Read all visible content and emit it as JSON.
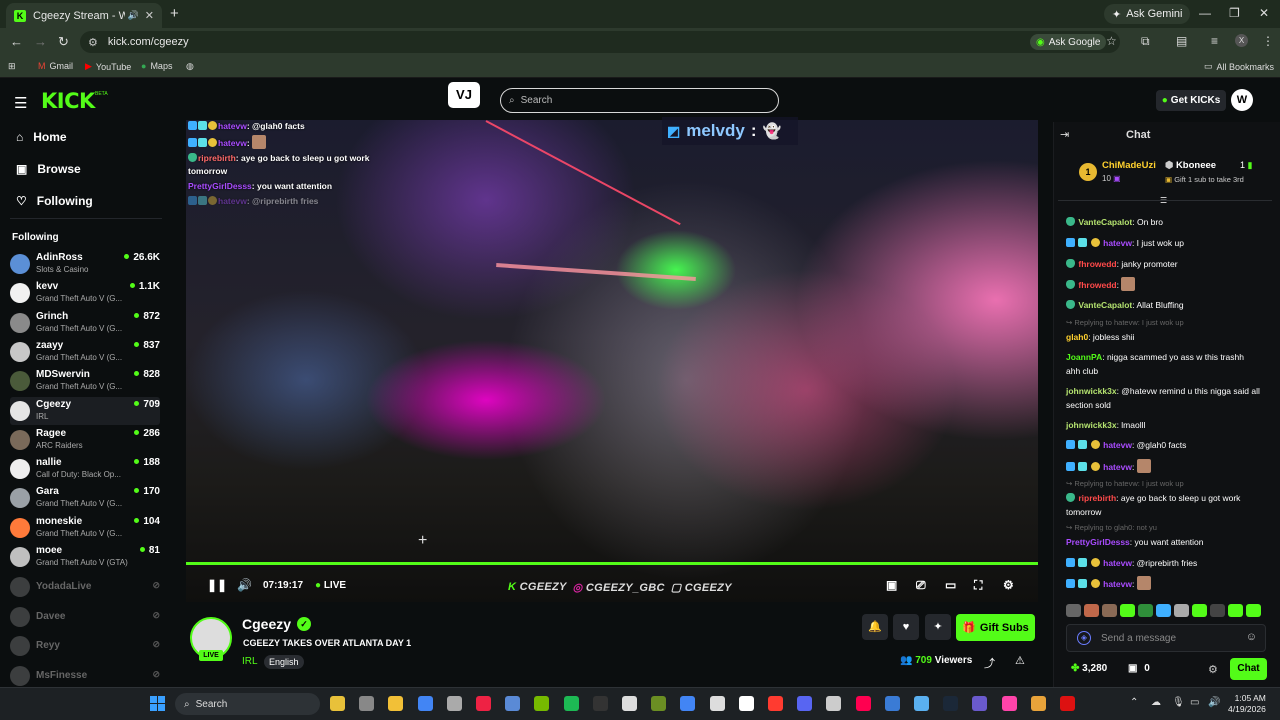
{
  "browser": {
    "tab_title": "Cgeezy Stream - Watch Live",
    "ask_gemini": "Ask Gemini",
    "url": "kick.com/cgeezy",
    "ask_google": "Ask Google",
    "bookmarks": [
      "Gmail",
      "YouTube",
      "Maps"
    ],
    "all_bookmarks": "All Bookmarks"
  },
  "header": {
    "logo": "KICK",
    "logo_tag": "BETA",
    "search_placeholder": "Search",
    "get_kicks": "Get KICKs"
  },
  "sidebar": {
    "nav": [
      "Home",
      "Browse",
      "Following"
    ],
    "section_label": "Following",
    "channels": [
      {
        "name": "AdinRoss",
        "category": "Slots & Casino",
        "viewers": "26.6K",
        "color": "#5b8fd6"
      },
      {
        "name": "kevv",
        "category": "Grand Theft Auto V (G...",
        "viewers": "1.1K",
        "color": "#f1f1f1"
      },
      {
        "name": "Grinch",
        "category": "Grand Theft Auto V (G...",
        "viewers": "872",
        "color": "#8a8a8a"
      },
      {
        "name": "zaayy",
        "category": "Grand Theft Auto V (G...",
        "viewers": "837",
        "color": "#c7c7c7"
      },
      {
        "name": "MDSwervin",
        "category": "Grand Theft Auto V (G...",
        "viewers": "828",
        "color": "#4a5a3a"
      },
      {
        "name": "Cgeezy",
        "category": "IRL",
        "viewers": "709",
        "color": "#e5e5e5"
      },
      {
        "name": "Ragee",
        "category": "ARC Raiders",
        "viewers": "286",
        "color": "#7a6a5a"
      },
      {
        "name": "nallie",
        "category": "Call of Duty: Black Op...",
        "viewers": "188",
        "color": "#eeeeee"
      },
      {
        "name": "Gara",
        "category": "Grand Theft Auto V (G...",
        "viewers": "170",
        "color": "#9aa0a6"
      },
      {
        "name": "moneskie",
        "category": "Grand Theft Auto V (G...",
        "viewers": "104",
        "color": "#ff7a3a"
      },
      {
        "name": "moee",
        "category": "Grand Theft Auto V (GTA)",
        "viewers": "81",
        "color": "#bfbfbf"
      }
    ],
    "offline": [
      "YodadaLive",
      "Davee",
      "Reyy",
      "MsFinesse"
    ]
  },
  "player": {
    "overlay_chat": [
      {
        "user": "hatevw",
        "text": ": @glah0 facts",
        "color": "purple"
      },
      {
        "user": "hatevw",
        "text": ":",
        "color": "purple"
      },
      {
        "user": "riprebirth",
        "text": ": aye go back to sleep u got work tomorrow",
        "color": "green"
      },
      {
        "user": "PrettyGirlDesss",
        "text": ": you want attention",
        "color": "purple"
      },
      {
        "user": "hatevw",
        "text": ": @riprebirth fries",
        "color": "purple"
      }
    ],
    "overlay_name": "melvdy",
    "overlay_sep": ":",
    "time": "07:19:17",
    "live": "LIVE",
    "socials": [
      "CGEEZY",
      "CGEEZY_GBC",
      "CGEEZY"
    ]
  },
  "stream": {
    "name": "Cgeezy",
    "title": "CGEEZY TAKES OVER ATLANTA DAY 1",
    "category": "IRL",
    "language": "English",
    "live_badge": "LIVE",
    "gift_subs": "Gift Subs",
    "viewer_count": "709",
    "viewer_label": "Viewers"
  },
  "chat": {
    "title": "Chat",
    "pinned": {
      "rank": "1",
      "user1": "ChiMadeUzi",
      "user1_count": "10",
      "user2": "Kboneee",
      "user2_count": "1",
      "subtext": "Gift 1 sub to take 3rd"
    },
    "messages": [
      {
        "user": "VanteCapalot",
        "text": ": On bro",
        "color": "#b4e26f"
      },
      {
        "user": "hatevw",
        "text": ": I just wok up",
        "color": "#a94cff"
      },
      {
        "user": "fhrowedd",
        "text": ": janky promoter",
        "color": "#ff4a4a"
      },
      {
        "user": "fhrowedd",
        "text": ":",
        "color": "#ff4a4a"
      },
      {
        "user": "VanteCapalot",
        "text": ": Allat Bluffing",
        "color": "#b4e26f"
      },
      {
        "user": "glah0",
        "text": ": jobless shii",
        "color": "#ffd12e",
        "reply": "Replying to hatevw: I just wok up"
      },
      {
        "user": "JoannPA",
        "text": ": nigga scammed yo ass w this trashh ahh club",
        "color": "#53fc18"
      },
      {
        "user": "johnwickk3x",
        "text": ": @hatevw remind u this nigga said all section sold",
        "color": "#b4e26f"
      },
      {
        "user": "johnwickk3x",
        "text": ": lmaolll",
        "color": "#b4e26f"
      },
      {
        "user": "hatevw",
        "text": ": @glah0 facts",
        "color": "#a94cff"
      },
      {
        "user": "hatevw",
        "text": ":",
        "color": "#a94cff"
      },
      {
        "user": "riprebirth",
        "text": ": aye go back to sleep u got work tomorrow",
        "color": "#ff4a4a",
        "reply": "Replying to hatevw: I just wok up"
      },
      {
        "user": "PrettyGirlDesss",
        "text": ": you want attention",
        "color": "#a94cff",
        "reply": "Replying to glah0: not yu"
      },
      {
        "user": "hatevw",
        "text": ": @riprebirth fries",
        "color": "#a94cff"
      },
      {
        "user": "hatevw",
        "text": ":",
        "color": "#a94cff"
      }
    ],
    "input_placeholder": "Send a message",
    "kicks": "3,280",
    "gifts": "0",
    "send": "Chat"
  },
  "taskbar": {
    "search": "Search",
    "time": "1:05 AM",
    "date": "4/19/2026"
  }
}
